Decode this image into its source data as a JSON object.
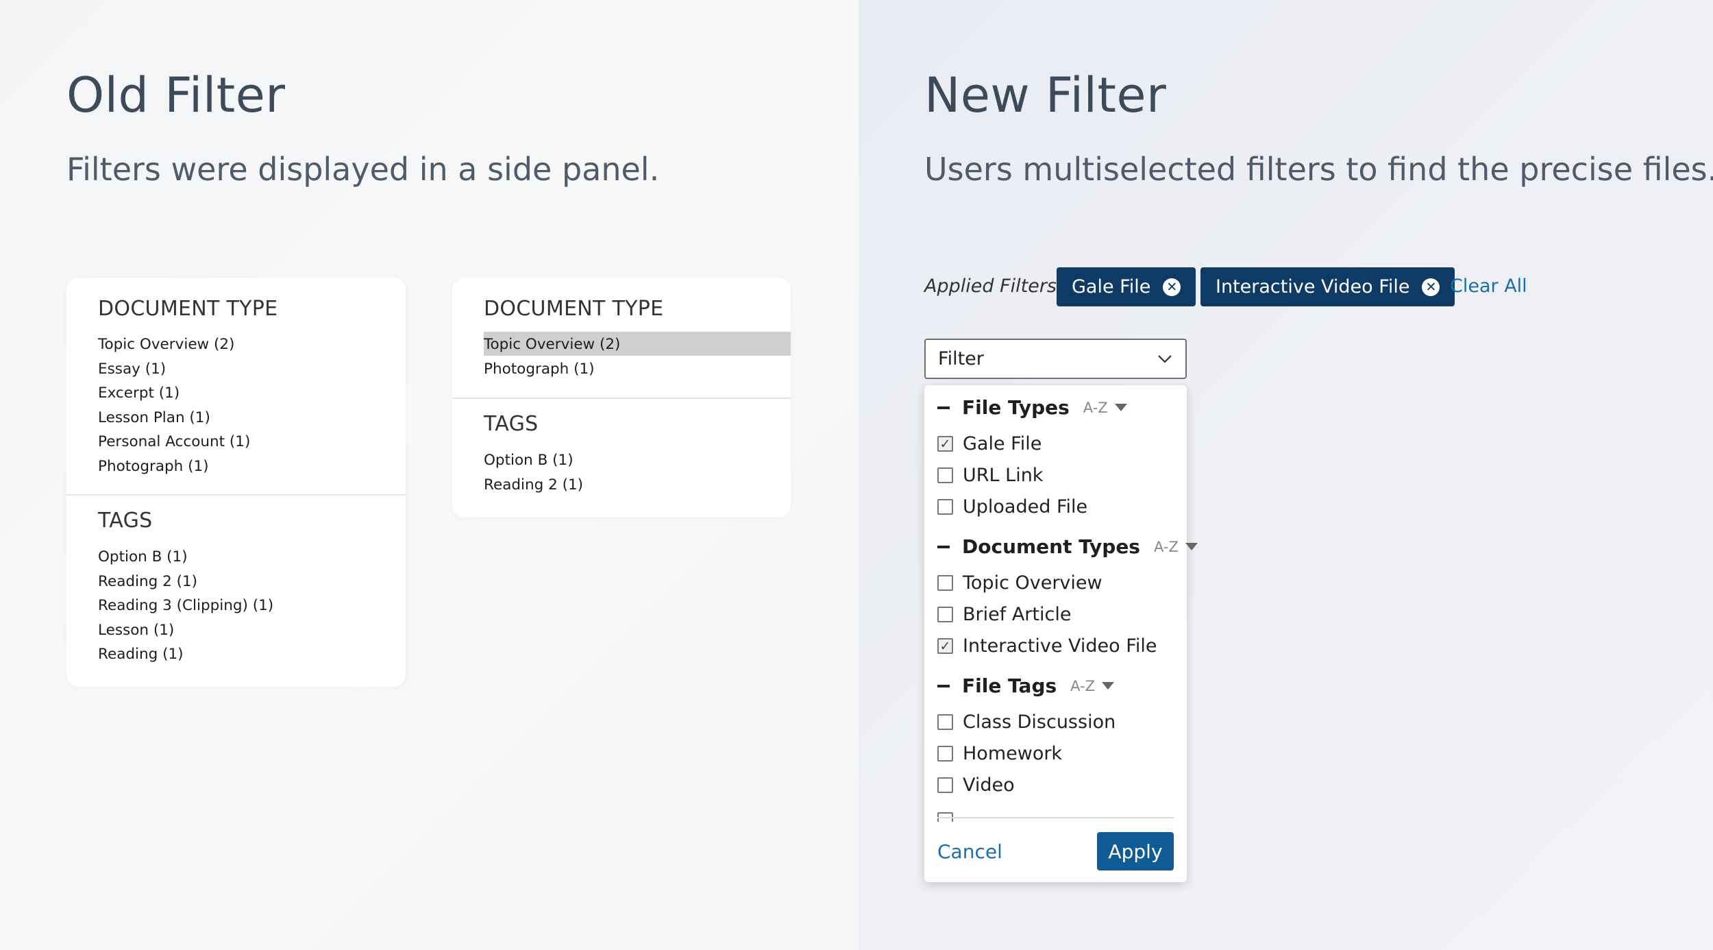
{
  "old_filter": {
    "title": "Old Filter",
    "subtitle": "Filters were displayed in a side panel.",
    "panel_a": {
      "document_type": {
        "title": "DOCUMENT TYPE",
        "items": [
          "Topic Overview (2)",
          "Essay (1)",
          "Excerpt (1)",
          "Lesson Plan (1)",
          "Personal Account (1)",
          "Photograph (1)"
        ]
      },
      "tags": {
        "title": "TAGS",
        "items": [
          "Option B (1)",
          "Reading 2 (1)",
          "Reading 3 (Clipping) (1)",
          "Lesson (1)",
          "Reading (1)"
        ]
      }
    },
    "panel_b": {
      "document_type": {
        "title": "DOCUMENT TYPE",
        "items": [
          "Topic Overview (2)",
          "Photograph (1)"
        ],
        "highlighted_index": 0
      },
      "tags": {
        "title": "TAGS",
        "items": [
          "Option B (1)",
          "Reading 2 (1)"
        ]
      }
    }
  },
  "new_filter": {
    "title": "New Filter",
    "subtitle": "Users multiselected filters to find the precise files.",
    "applied_label": "Applied Filters:",
    "chips": [
      {
        "label": "Gale File"
      },
      {
        "label": "Interactive Video File"
      }
    ],
    "clear_all": "Clear All",
    "select": {
      "value": "Filter"
    },
    "groups": [
      {
        "label": "File Types",
        "sort": "A-Z",
        "options": [
          {
            "label": "Gale File",
            "checked": true
          },
          {
            "label": "URL Link",
            "checked": false
          },
          {
            "label": "Uploaded File",
            "checked": false
          }
        ]
      },
      {
        "label": "Document Types",
        "sort": "A-Z",
        "options": [
          {
            "label": "Topic Overview",
            "checked": false
          },
          {
            "label": "Brief Article",
            "checked": false
          },
          {
            "label": "Interactive Video File",
            "checked": true
          }
        ]
      },
      {
        "label": "File Tags",
        "sort": "A-Z",
        "options": [
          {
            "label": "Class Discussion",
            "checked": false
          },
          {
            "label": "Homework",
            "checked": false
          },
          {
            "label": "Video",
            "checked": false
          }
        ]
      }
    ],
    "cancel": "Cancel",
    "apply": "Apply"
  },
  "colors": {
    "chip_bg": "#0d3b66",
    "link": "#1a6fa8",
    "apply_bg": "#0f5b96",
    "highlight": "#cfcfcf"
  }
}
